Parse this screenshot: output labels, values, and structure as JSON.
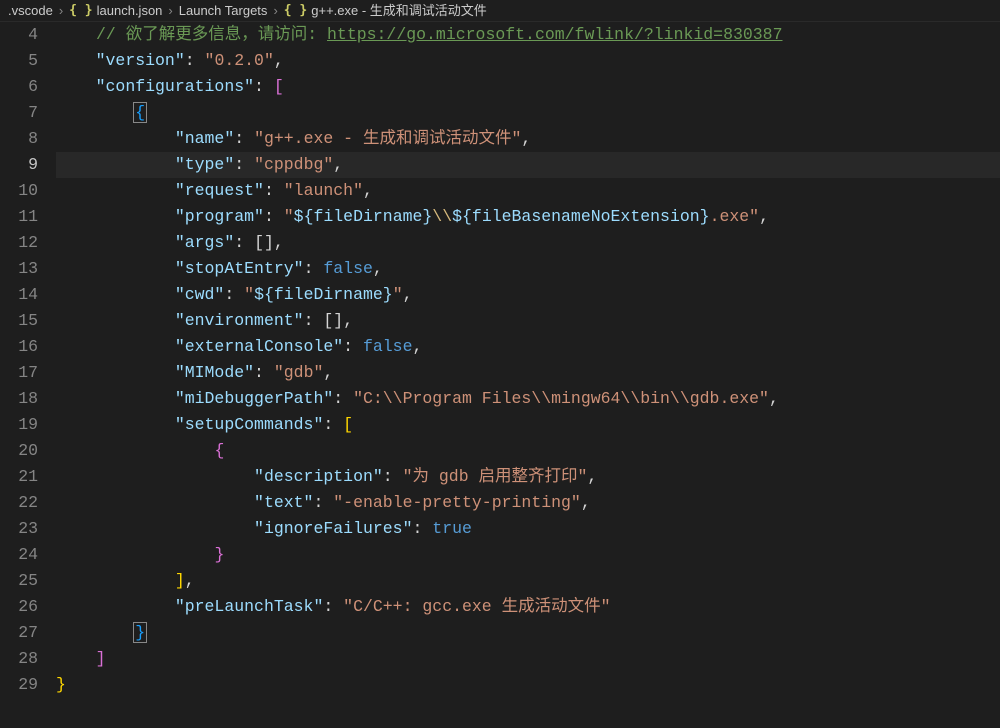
{
  "breadcrumb": {
    "folder": ".vscode",
    "file": "launch.json",
    "section": "Launch Targets",
    "target": "g++.exe - 生成和调试活动文件"
  },
  "gutter": {
    "start": 4,
    "end": 29,
    "active": 9
  },
  "content": {
    "comment_prefix": "// 欲了解更多信息，请访问: ",
    "comment_url": "https://go.microsoft.com/fwlink/?linkid=830387",
    "version_key": "\"version\"",
    "version_val": "\"0.2.0\"",
    "configurations_key": "\"configurations\"",
    "name_key": "\"name\"",
    "name_val": "\"g++.exe - 生成和调试活动文件\"",
    "type_key": "\"type\"",
    "type_val": "\"cppdbg\"",
    "request_key": "\"request\"",
    "request_val": "\"launch\"",
    "program_key": "\"program\"",
    "program_prefix": "\"",
    "program_var1": "${fileDirname}",
    "program_mid": "\\\\",
    "program_var2": "${fileBasenameNoExtension}",
    "program_suffix": ".exe\"",
    "args_key": "\"args\"",
    "stopAtEntry_key": "\"stopAtEntry\"",
    "cwd_key": "\"cwd\"",
    "cwd_prefix": "\"",
    "cwd_var": "${fileDirname}",
    "cwd_suffix": "\"",
    "environment_key": "\"environment\"",
    "externalConsole_key": "\"externalConsole\"",
    "MIMode_key": "\"MIMode\"",
    "MIMode_val": "\"gdb\"",
    "miDebuggerPath_key": "\"miDebuggerPath\"",
    "miDebuggerPath_val": "\"C:\\\\Program Files\\\\mingw64\\\\bin\\\\gdb.exe\"",
    "setupCommands_key": "\"setupCommands\"",
    "description_key": "\"description\"",
    "description_val": "\"为 gdb 启用整齐打印\"",
    "text_key": "\"text\"",
    "text_val": "\"-enable-pretty-printing\"",
    "ignoreFailures_key": "\"ignoreFailures\"",
    "preLaunchTask_key": "\"preLaunchTask\"",
    "preLaunchTask_val": "\"C/C++: gcc.exe 生成活动文件\"",
    "false_lit": "false",
    "true_lit": "true",
    "empty_arr": "[]"
  }
}
